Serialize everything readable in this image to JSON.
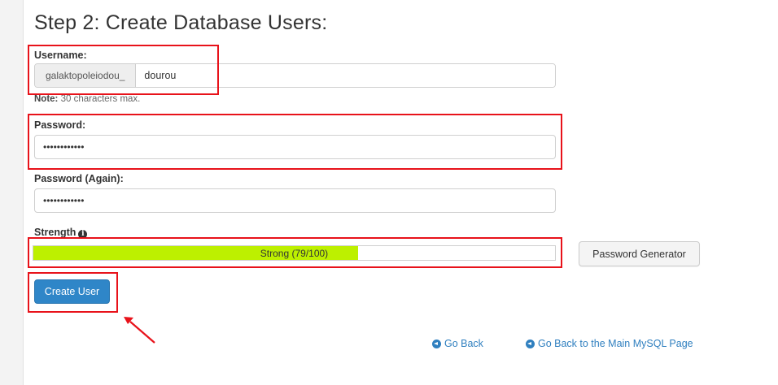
{
  "page": {
    "title": "Step 2: Create Database Users:"
  },
  "username": {
    "label": "Username:",
    "prefix": "galaktopoleiodou_",
    "value": "dourou",
    "note_bold": "Note:",
    "note_text": " 30 characters max."
  },
  "password": {
    "label": "Password:",
    "value": "••••••••••••"
  },
  "password_again": {
    "label": "Password (Again):",
    "value": "••••••••••••"
  },
  "strength": {
    "label": "Strength",
    "info_glyph": "i",
    "meter_text": "Strong (79/100)",
    "score": 79,
    "max": 100,
    "fill_color": "#bdf000"
  },
  "buttons": {
    "password_generator": "Password Generator",
    "create_user": "Create User"
  },
  "links": {
    "go_back": "Go Back",
    "go_back_main": "Go Back to the Main MySQL Page"
  },
  "colors": {
    "primary": "#2f86c8",
    "link": "#2f7fbf",
    "annotation_red": "#e8121a"
  },
  "icons": {
    "strength_info": "info-circle-icon",
    "go_back": "circle-arrow-left-icon",
    "annotation": "red-arrow-icon"
  }
}
